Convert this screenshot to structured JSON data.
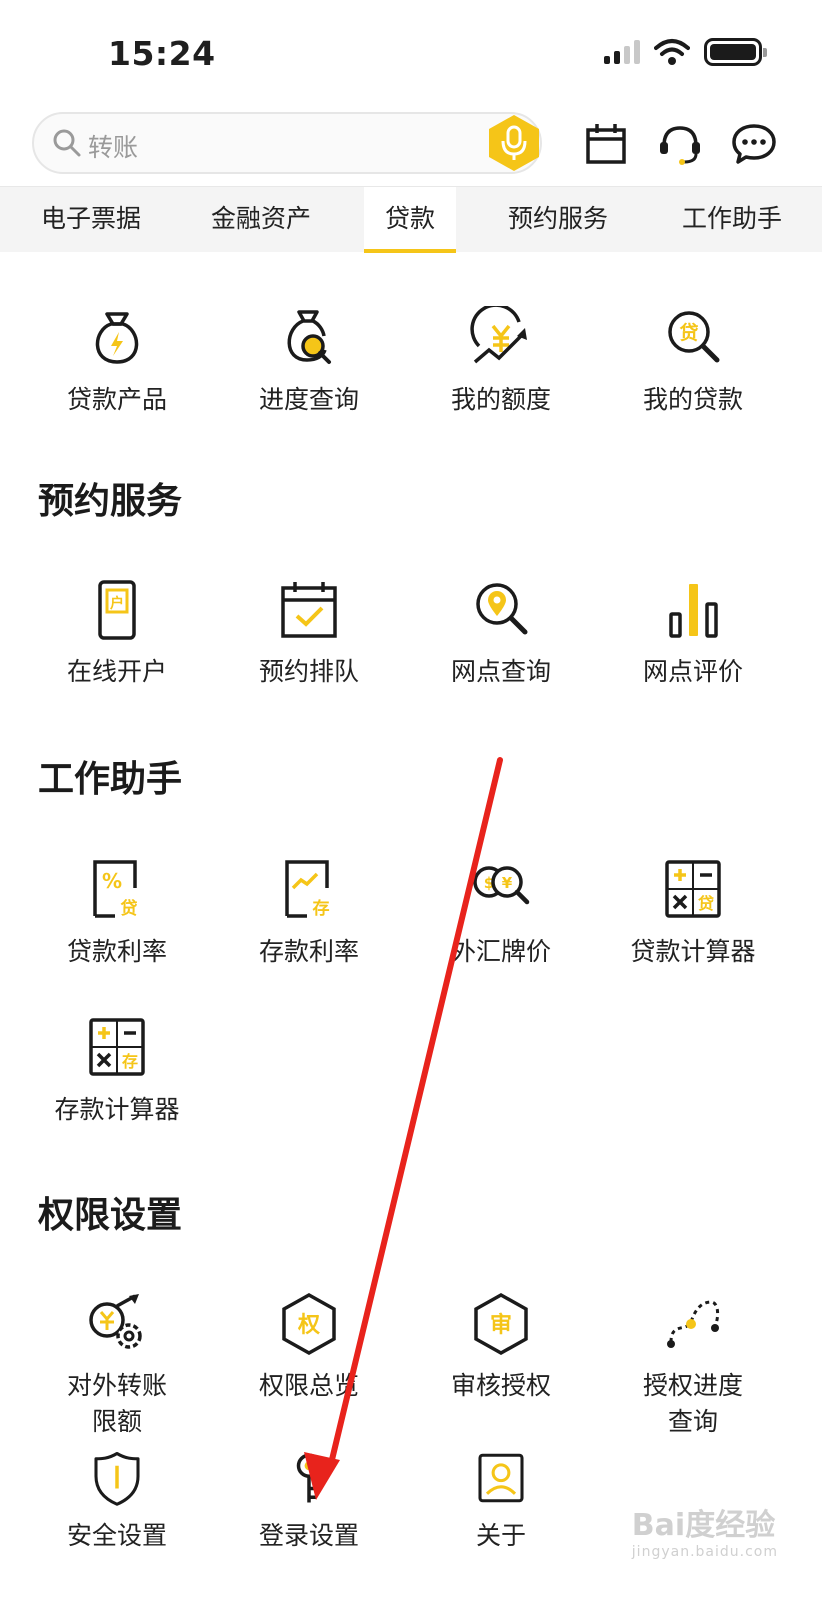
{
  "status_bar": {
    "time": "15:24"
  },
  "search": {
    "placeholder": "转账"
  },
  "tabs": [
    {
      "label": "电子票据"
    },
    {
      "label": "金融资产"
    },
    {
      "label": "贷款",
      "active": true
    },
    {
      "label": "预约服务"
    },
    {
      "label": "工作助手"
    }
  ],
  "loan": {
    "items": [
      {
        "label": "贷款产品",
        "icon": "money-bag-lightning-icon"
      },
      {
        "label": "进度查询",
        "icon": "money-bag-search-icon"
      },
      {
        "label": "我的额度",
        "icon": "yen-growth-icon"
      },
      {
        "label": "我的贷款",
        "icon": "loan-search-icon"
      }
    ]
  },
  "appointment": {
    "title": "预约服务",
    "items": [
      {
        "label": "在线开户",
        "icon": "phone-account-icon"
      },
      {
        "label": "预约排队",
        "icon": "calendar-check-icon"
      },
      {
        "label": "网点查询",
        "icon": "location-search-icon"
      },
      {
        "label": "网点评价",
        "icon": "bar-rating-icon"
      }
    ]
  },
  "assistant": {
    "title": "工作助手",
    "items": [
      {
        "label": "贷款利率",
        "icon": "loan-rate-icon"
      },
      {
        "label": "存款利率",
        "icon": "deposit-rate-icon"
      },
      {
        "label": "外汇牌价",
        "icon": "forex-icon"
      },
      {
        "label": "贷款计算器",
        "icon": "loan-calculator-icon"
      },
      {
        "label": "存款计算器",
        "icon": "deposit-calculator-icon"
      }
    ]
  },
  "permissions": {
    "title": "权限设置",
    "items": [
      {
        "label": "对外转账\n限额",
        "line1": "对外转账",
        "line2": "限额",
        "icon": "transfer-limit-icon"
      },
      {
        "label": "权限总览",
        "icon": "permission-overview-icon",
        "glyph": "权"
      },
      {
        "label": "审核授权",
        "icon": "review-authorize-icon",
        "glyph": "审"
      },
      {
        "label": "授权进度\n查询",
        "line1": "授权进度",
        "line2": "查询",
        "icon": "authorize-progress-icon"
      },
      {
        "label": "安全设置",
        "icon": "shield-icon"
      },
      {
        "label": "登录设置",
        "icon": "login-key-icon"
      },
      {
        "label": "关于",
        "icon": "about-icon"
      }
    ]
  },
  "watermark": {
    "text": "Bai度经验",
    "url": "jingyan.baidu.com"
  },
  "colors": {
    "accent": "#f5c518",
    "arrow": "#e8231c",
    "icon_stroke": "#1b1b1b"
  }
}
